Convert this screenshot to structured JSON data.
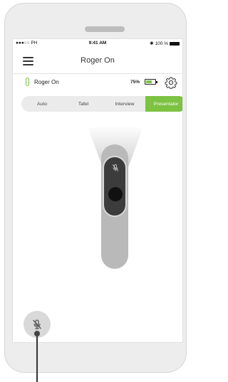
{
  "status_bar": {
    "carrier": "●●●○○ PH",
    "time": "9:41 AM",
    "battery": "100 %"
  },
  "header": {
    "title": "Roger On"
  },
  "device": {
    "name": "Roger On",
    "battery_percent": "75%",
    "battery_level": 0.75
  },
  "tabs": [
    {
      "label": "Auto",
      "active": false
    },
    {
      "label": "Tafel",
      "active": false
    },
    {
      "label": "Interview",
      "active": false
    },
    {
      "label": "Presentator",
      "active": true
    }
  ],
  "colors": {
    "accent": "#7dc242",
    "mute_button": "#d9d9d9"
  },
  "icons": {
    "menu": "menu-icon",
    "gear": "gear-icon",
    "mic_off": "mic-off-icon",
    "device": "device-icon",
    "battery": "battery-icon"
  }
}
